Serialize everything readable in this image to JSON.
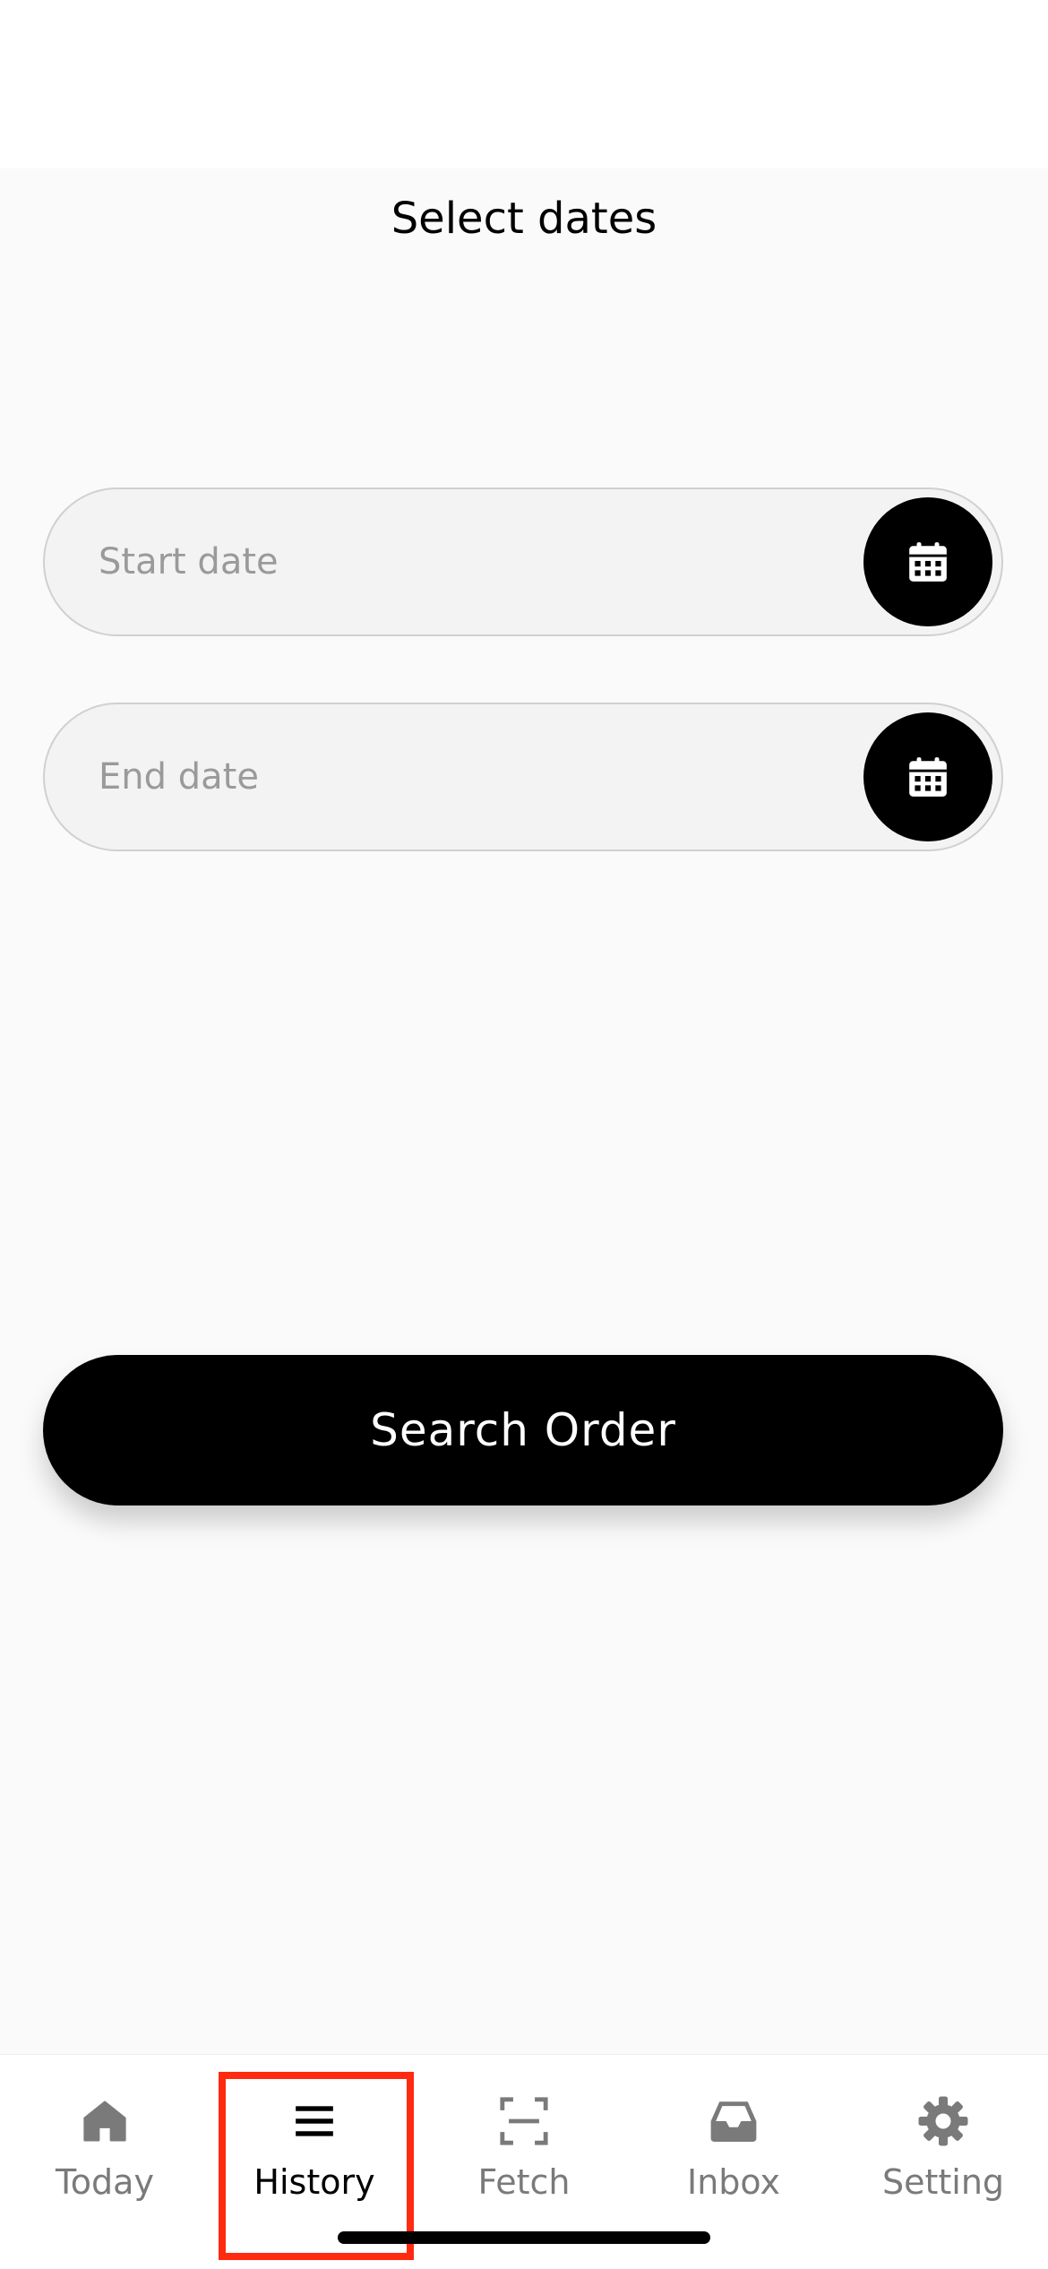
{
  "header": {
    "title": "Select dates"
  },
  "form": {
    "start_date": {
      "value": "",
      "placeholder": "Start date",
      "icon": "calendar-icon"
    },
    "end_date": {
      "value": "",
      "placeholder": "End date",
      "icon": "calendar-icon"
    },
    "search_button_label": "Search Order"
  },
  "tabbar": {
    "active": "History",
    "items": [
      {
        "label": "Today",
        "icon": "home-icon"
      },
      {
        "label": "History",
        "icon": "menu-icon"
      },
      {
        "label": "Fetch",
        "icon": "scan-icon"
      },
      {
        "label": "Inbox",
        "icon": "inbox-icon"
      },
      {
        "label": "Setting",
        "icon": "gear-icon"
      }
    ]
  },
  "colors": {
    "accent": "#000000",
    "field_background": "#f3f3f3",
    "inactive_tab": "#7a7a7a",
    "highlight": "#ff2a10"
  }
}
